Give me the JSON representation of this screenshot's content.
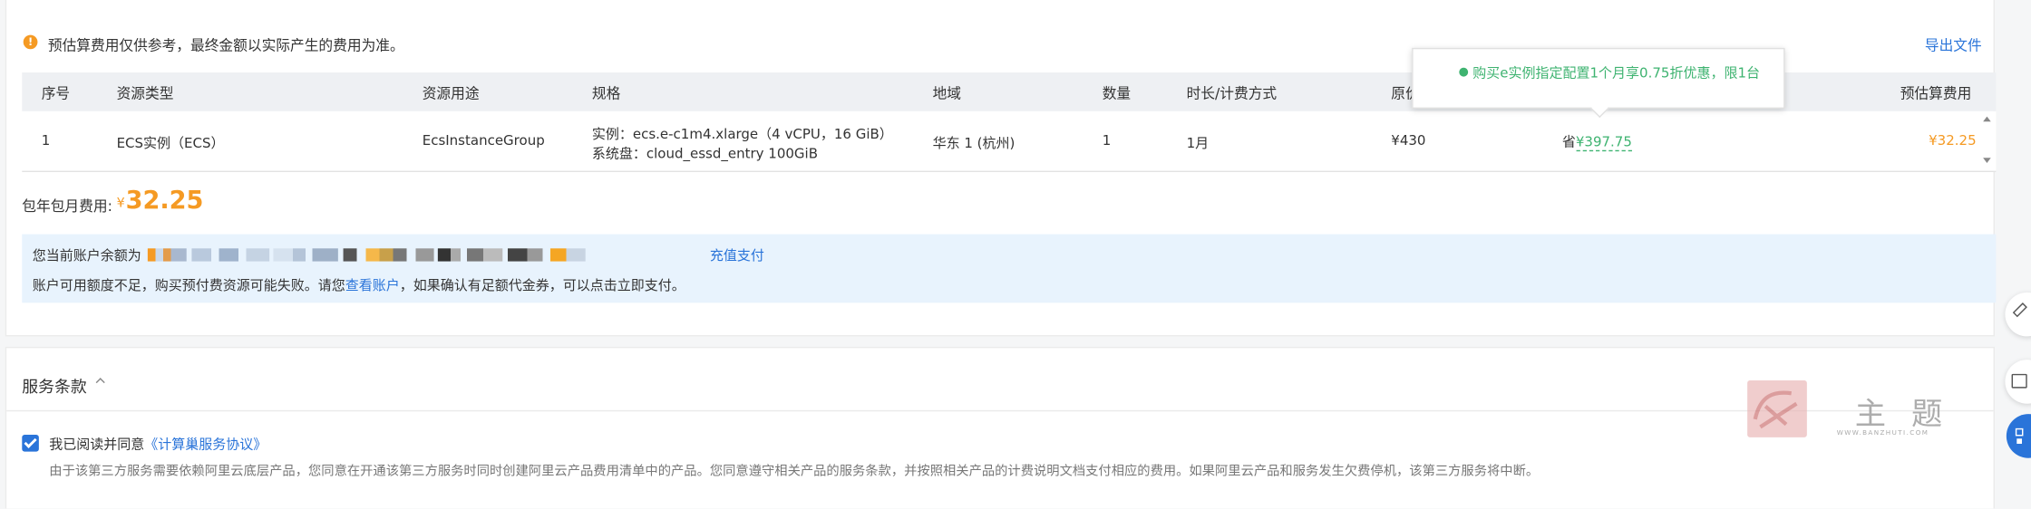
{
  "notice": {
    "text": "预估算费用仅供参考，最终金额以实际产生的费用为准。",
    "export_label": "导出文件"
  },
  "table": {
    "headers": [
      "序号",
      "资源类型",
      "资源用途",
      "规格",
      "地域",
      "数量",
      "时长/计费方式",
      "原价",
      "",
      "预估算费用"
    ],
    "row": {
      "index": "1",
      "type": "ECS实例（ECS）",
      "usage": "EcsInstanceGroup",
      "spec_line1": "实例：ecs.e-c1m4.xlarge（4 vCPU，16 GiB）",
      "spec_line2": "系统盘：cloud_essd_entry 100GiB",
      "region": "华东 1 (杭州)",
      "qty": "1",
      "duration": "1月",
      "original_price": "¥430",
      "discount_prefix": "省",
      "discount_value": "¥397.75",
      "estimate": "¥32.25"
    }
  },
  "tooltip": {
    "text": "购买e实例指定配置1个月享0.75折优惠，限1台"
  },
  "total": {
    "label": "包年包月费用:",
    "currency": "¥",
    "amount": "32.25"
  },
  "balance": {
    "prefix": "您当前账户余额为",
    "recharge_label": "充值支付",
    "line2_a": "账户可用额度不足，购买预付费资源可能失败。请您",
    "line2_link": "查看账户",
    "line2_b": "，如果确认有足额代金券，可以点击立即支付。"
  },
  "terms": {
    "title": "服务条款",
    "agree_prefix": "我已阅读并同意",
    "agree_link": "《计算巢服务协议》",
    "desc": "由于该第三方服务需要依赖阿里云底层产品，您同意在开通该第三方服务时同时创建阿里云产品费用清单中的产品。您同意遵守相关产品的服务条款，并按照相关产品的计费说明文档支付相应的费用。如果阿里云产品和服务发生欠费停机，该第三方服务将中断。"
  },
  "watermark": {
    "text": "主 题",
    "sub": "WWW.BANZHUTI.COM"
  },
  "colors": {
    "accent": "#2a74d9",
    "orange": "#f59a23",
    "green": "#3eb370",
    "info_bg": "#e8f3fd"
  }
}
